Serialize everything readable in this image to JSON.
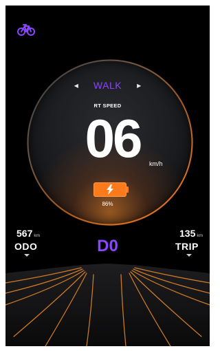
{
  "header": {
    "icon": "bicycle-icon",
    "accent": "#8a45ff"
  },
  "dial": {
    "mode": "WALK",
    "mode_prev_icon": "triangle-left-icon",
    "mode_next_icon": "triangle-right-icon",
    "speed_label": "RT SPEED",
    "speed_value": "06",
    "speed_unit": "km/h"
  },
  "battery": {
    "icon": "lightning-bolt-icon",
    "percent_text": "86%",
    "color": "#ff7a1a"
  },
  "odo": {
    "value": "567",
    "unit": "km",
    "label": "ODO"
  },
  "trip": {
    "value": "135",
    "unit": "km",
    "label": "TRIP"
  },
  "gear": {
    "label": "D0"
  }
}
